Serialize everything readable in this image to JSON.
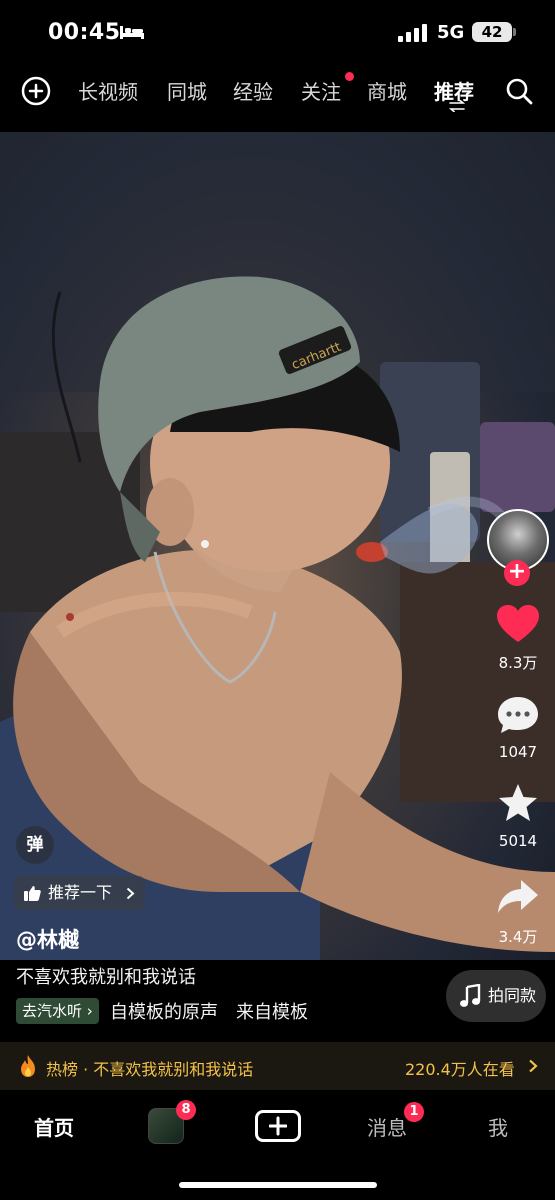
{
  "status": {
    "time": "00:45",
    "network": "5G",
    "battery": "42"
  },
  "top_nav": {
    "tabs": [
      "长视频",
      "同城",
      "经验",
      "关注",
      "商城",
      "推荐"
    ],
    "active_tab": "推荐"
  },
  "video": {
    "cap_logo_text": "carhartt"
  },
  "actions": {
    "likes": "8.3万",
    "comments": "1047",
    "favorites": "5014",
    "shares": "3.4万"
  },
  "overlay": {
    "danmu_label": "弹",
    "recommend_label": "推荐一下",
    "username": "@林樾",
    "caption": "不喜欢我就别和我说话",
    "sound_tag": "去汽水听",
    "sound_name": "自模板的原声　来自模板",
    "same_sound_label": "拍同款"
  },
  "hot_bar": {
    "text": "热榜 · 不喜欢我就别和我说话",
    "viewers": "220.4万人在看"
  },
  "tab_bar": {
    "home": "首页",
    "friends_badge": "8",
    "messages": "消息",
    "messages_badge": "1",
    "me": "我"
  },
  "colors": {
    "accent_red": "#fe2c55",
    "hot_gold": "#f3c24a"
  }
}
